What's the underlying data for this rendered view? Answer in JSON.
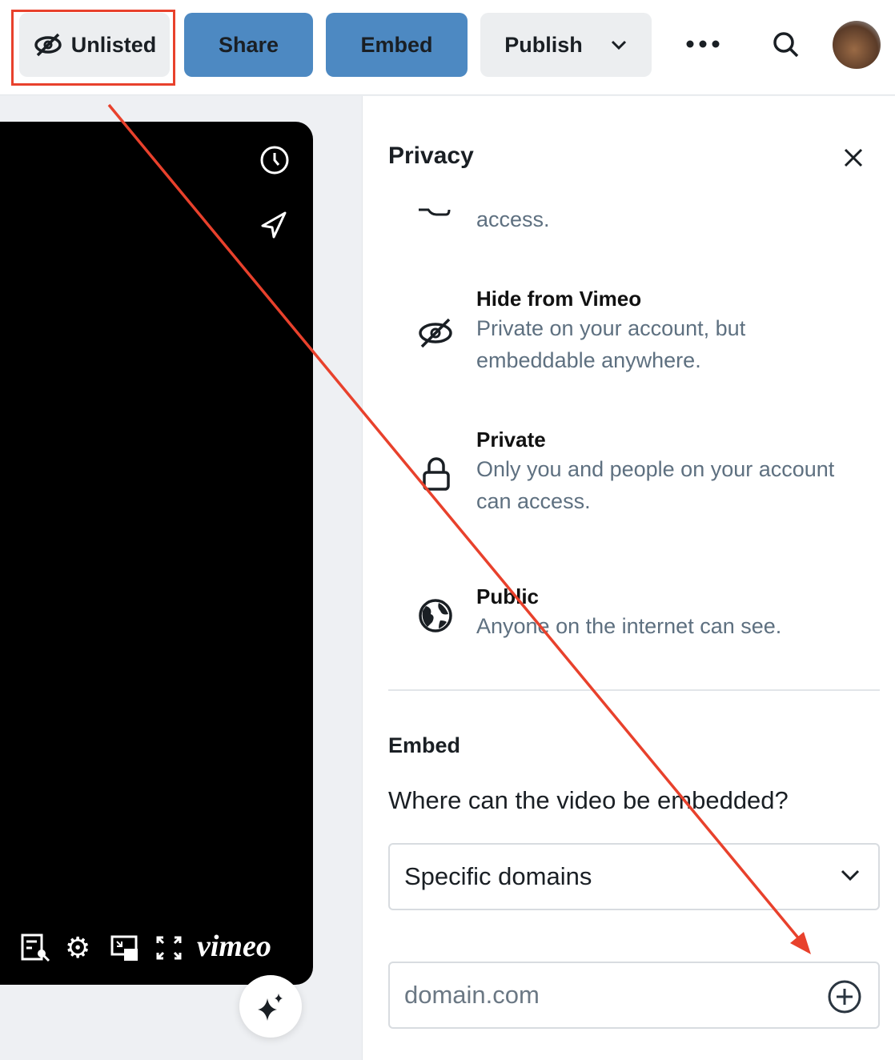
{
  "toolbar": {
    "unlisted_label": "Unlisted",
    "share_label": "Share",
    "embed_label": "Embed",
    "publish_label": "Publish"
  },
  "player": {
    "logo": "vimeo"
  },
  "privacy": {
    "title": "Privacy",
    "partial_desc": "access.",
    "options": [
      {
        "title": "Hide from Vimeo",
        "desc": "Private on your account, but embeddable anywhere.",
        "icon": "eye-slash-icon"
      },
      {
        "title": "Private",
        "desc": "Only you and people on your account can access.",
        "icon": "lock-icon"
      },
      {
        "title": "Public",
        "desc": "Anyone on the internet can see.",
        "icon": "globe-icon"
      }
    ]
  },
  "embed": {
    "heading": "Embed",
    "question": "Where can the video be embedded?",
    "select_value": "Specific domains",
    "domain_placeholder": "domain.com"
  },
  "colors": {
    "accent": "#4d89c2",
    "annotation": "#e8412c"
  }
}
